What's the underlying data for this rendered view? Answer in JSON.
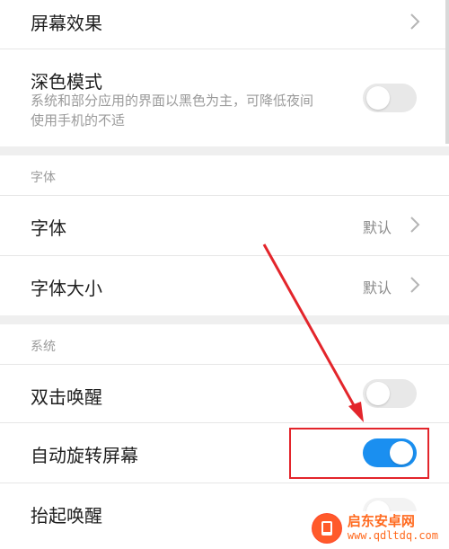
{
  "settings": {
    "screen_effect": {
      "title": "屏幕效果"
    },
    "dark_mode": {
      "title": "深色模式",
      "subtitle_line1": "系统和部分应用的界面以黑色为主，可降低夜间",
      "subtitle_line2": "使用手机的不适",
      "toggle_state": "off"
    },
    "font_section": {
      "header": "字体",
      "font": {
        "title": "字体",
        "value": "默认"
      },
      "font_size": {
        "title": "字体大小",
        "value": "默认"
      }
    },
    "system_section": {
      "header": "系统",
      "double_tap_wake": {
        "title": "双击唤醒",
        "toggle_state": "off"
      },
      "auto_rotate": {
        "title": "自动旋转屏幕",
        "toggle_state": "on"
      },
      "raise_to_wake": {
        "title": "抬起唤醒"
      }
    }
  },
  "watermark": {
    "title": "启东安卓网",
    "url": "www.qdltdq.com"
  },
  "colors": {
    "accent": "#1a8ff0",
    "annotation": "#e3252b",
    "watermark": "#ff6a1f"
  }
}
